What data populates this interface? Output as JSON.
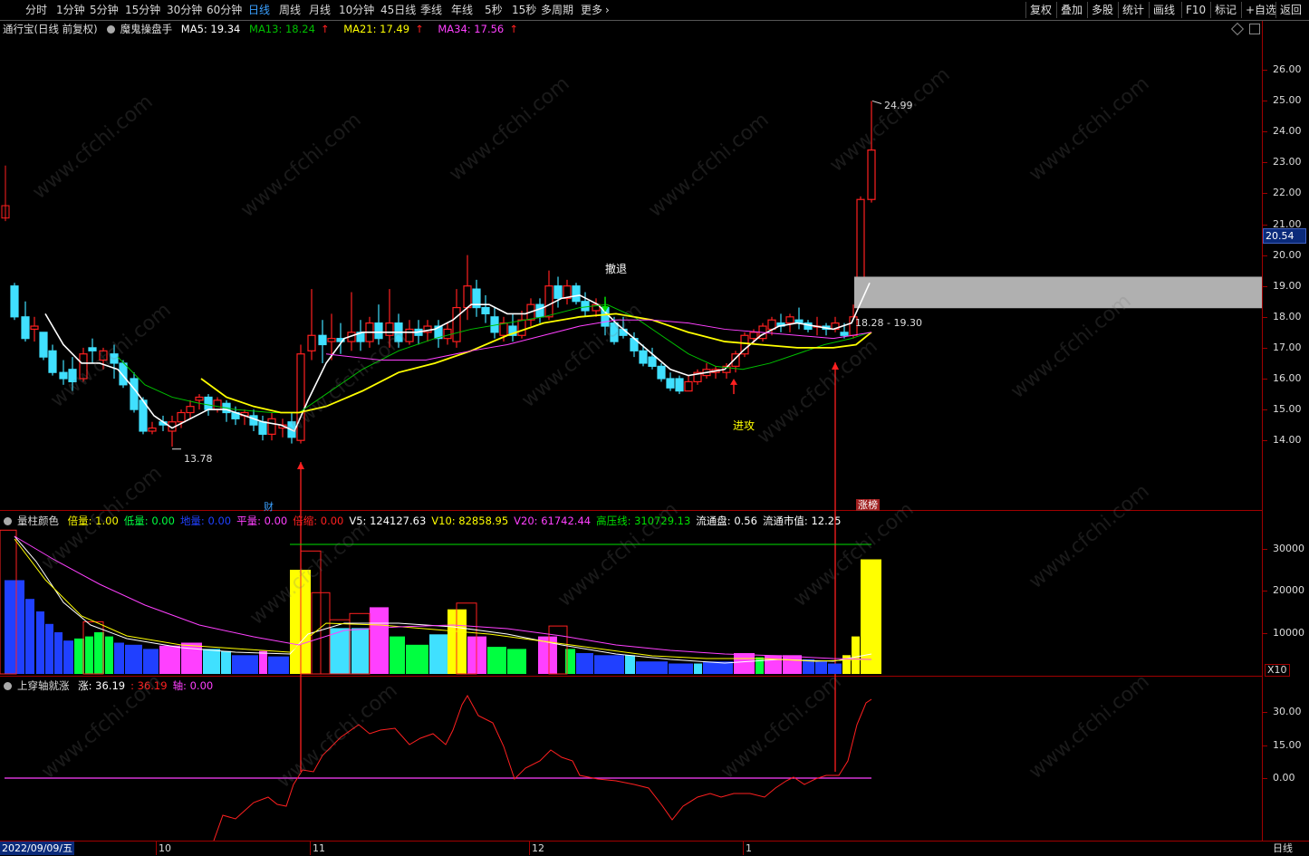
{
  "toolbar": {
    "periods": [
      "分时",
      "1分钟",
      "5分钟",
      "15分钟",
      "30分钟",
      "60分钟",
      "日线",
      "周线",
      "月线",
      "10分钟",
      "45日线",
      "季线",
      "年线",
      "5秒",
      "15秒",
      "多周期",
      "更多"
    ],
    "active_period": "日线",
    "right_buttons": [
      "复权",
      "叠加",
      "多股",
      "统计",
      "画线",
      "F10",
      "标记",
      "+自选",
      "返回"
    ],
    "more_icon": "chevron-right-icon"
  },
  "main_panel": {
    "stock_name": "通行宝(日线 前复权)",
    "indicator_name": "魔鬼操盘手",
    "ma5": "MA5: 19.34",
    "ma13": "MA13: 18.24",
    "ma21": "MA21: 17.49",
    "ma34": "MA34: 17.56",
    "colors": {
      "ma5": "#ffffff",
      "ma13": "#00c000",
      "ma21": "#ffff00",
      "ma34": "#ff40ff",
      "up": "#ff2020",
      "down": "#40e0ff"
    },
    "price_ticks": [
      "26.00",
      "25.00",
      "24.00",
      "23.00",
      "22.00",
      "21.00",
      "20.00",
      "19.00",
      "18.00",
      "17.00",
      "16.00",
      "15.00",
      "14.00"
    ],
    "current_price": "20.54",
    "high_label": "24.99",
    "low_label": "13.78",
    "range_label": "18.28 - 19.30",
    "signal_retreat": "撤退",
    "signal_attack": "进攻",
    "tag_cai": "财",
    "tag_zhangbang": "涨榜"
  },
  "volume_panel": {
    "name": "量柱颜色",
    "items": [
      {
        "label": "倍量: 1.00",
        "color": "#ffff00"
      },
      {
        "label": "低量: 0.00",
        "color": "#00ff40"
      },
      {
        "label": "地量: 0.00",
        "color": "#2040ff"
      },
      {
        "label": "平量: 0.00",
        "color": "#ff40ff"
      },
      {
        "label": "倍缩: 0.00",
        "color": "#ff2020"
      },
      {
        "label": "V5: 124127.63",
        "color": "#ffffff"
      },
      {
        "label": "V10: 82858.95",
        "color": "#ffff00"
      },
      {
        "label": "V20: 61742.44",
        "color": "#ff40ff"
      },
      {
        "label": "高压线: 310729.13",
        "color": "#00e000"
      },
      {
        "label": "流通盘: 0.56",
        "color": "#ffffff"
      },
      {
        "label": "流通市值: 12.25",
        "color": "#ffffff"
      }
    ],
    "ticks": [
      "30000",
      "20000",
      "10000"
    ],
    "unit": "X10"
  },
  "osc_panel": {
    "name": "上穿轴就涨",
    "items": [
      {
        "label": "涨: 36.19",
        "color": "#ffffff"
      },
      {
        "label": ": 36.19",
        "color": "#ff2020"
      },
      {
        "label": "轴: 0.00",
        "color": "#ff40ff"
      }
    ],
    "ticks": [
      "30.00",
      "15.00",
      "0.00"
    ]
  },
  "date_axis": {
    "start_date": "2022/09/09/五",
    "months": [
      "10",
      "11",
      "12",
      "1"
    ],
    "period_label": "日线"
  },
  "watermark": "www.cfchi.com"
}
